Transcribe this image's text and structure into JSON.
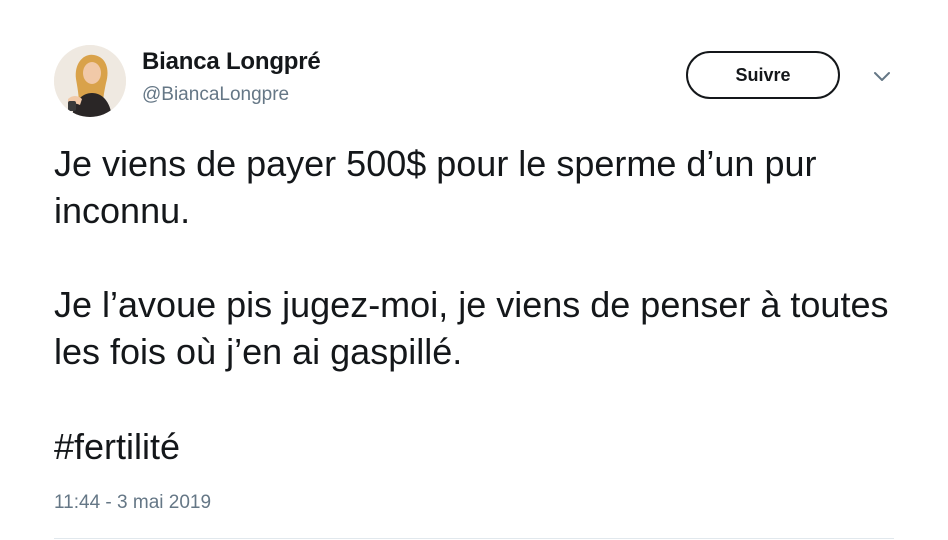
{
  "author": {
    "display_name": "Bianca Longpré",
    "handle": "@BiancaLongpre"
  },
  "follow_button": {
    "label": "Suivre"
  },
  "menu": {
    "icon": "chevron-down-icon"
  },
  "tweet": {
    "paragraph_1": "Je viens de payer 500$ pour le sperme d’un pur inconnu.",
    "paragraph_2": "Je l’avoue pis jugez-moi, je viens de penser à toutes les fois où j’en ai gaspillé.",
    "hashtag": "#fertilité",
    "timestamp": "11:44 - 3 mai 2019"
  },
  "colors": {
    "text": "#14171a",
    "secondary_text": "#657786",
    "divider": "#e1e8ed",
    "background": "#ffffff"
  }
}
